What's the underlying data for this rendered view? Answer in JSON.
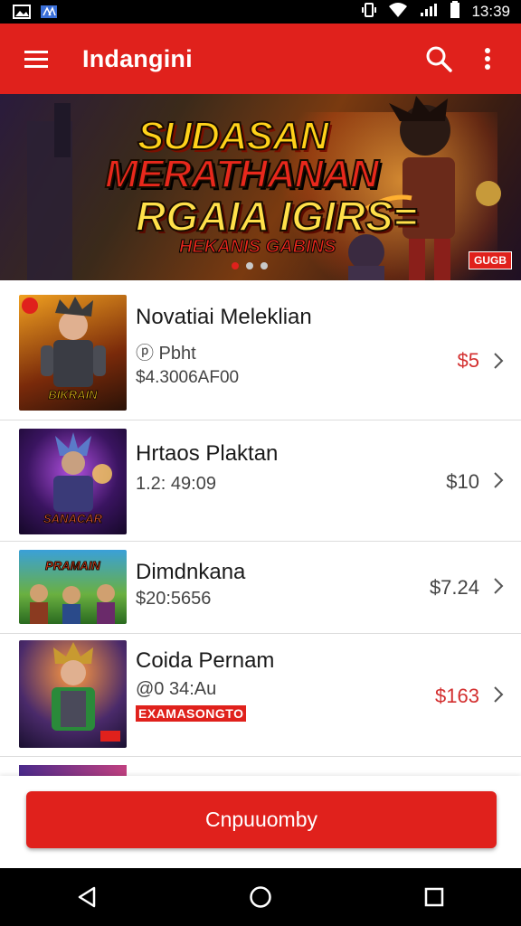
{
  "status_bar": {
    "time": "13:39"
  },
  "app_bar": {
    "title": "Indangini"
  },
  "banner": {
    "title_line1": "SUDASAN",
    "title_line2": "MERATHANAN",
    "title_line3": "RGAIA IGIRS=",
    "subtitle": "HEKANIS GABINS",
    "tag": "GUGB",
    "slide_count": 3,
    "active_slide": 1
  },
  "items": [
    {
      "name": "Novatiai Meleklian",
      "line2": "ⓟ Pbht",
      "line3": "$4.3006AF00",
      "price": "$5",
      "price_color": "#d32f2f",
      "thumb_label": "BIKRAIN",
      "promo": ""
    },
    {
      "name": "Hrtaos Plaktan",
      "line2": "1.2: 49:09",
      "line3": "",
      "price": "$10",
      "price_color": "#444444",
      "thumb_label": "SANACAR",
      "promo": ""
    },
    {
      "name": "Dimdnkana",
      "line2": "$20:5656",
      "line3": "",
      "price": "$7.24",
      "price_color": "#444444",
      "thumb_label": "PRAMAIN",
      "promo": ""
    },
    {
      "name": "Coida Pernam",
      "line2": "@0 34:Au",
      "line3": "",
      "price": "$163",
      "price_color": "#d32f2f",
      "thumb_label": "",
      "promo": "EXAMASONGTO"
    }
  ],
  "cta": {
    "label": "Cnpuuomby"
  },
  "colors": {
    "accent": "#e0211c",
    "status_bar": "#000000",
    "nav_bar": "#000000"
  }
}
